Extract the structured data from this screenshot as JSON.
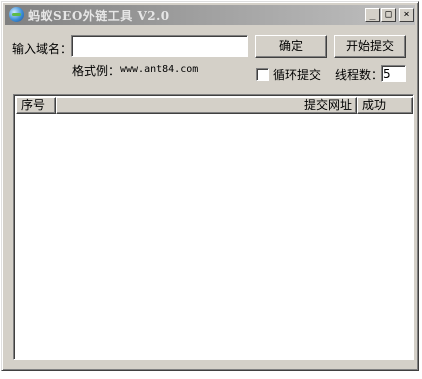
{
  "window": {
    "title": "蚂蚁SEO外链工具 V2.0",
    "controls": {
      "minimize": "_",
      "maximize": "□",
      "close": "×"
    }
  },
  "form": {
    "domain_label": "输入域名：",
    "domain_value": "",
    "example_label": "格式例：",
    "example_value": "www.ant84.com",
    "confirm_button": "确定",
    "start_button": "开始提交",
    "loop_label": "循环提交",
    "loop_checked": false,
    "threads_label": "线程数：",
    "threads_value": "5"
  },
  "list": {
    "columns": [
      "序号",
      "提交网址",
      "成功"
    ],
    "rows": []
  }
}
